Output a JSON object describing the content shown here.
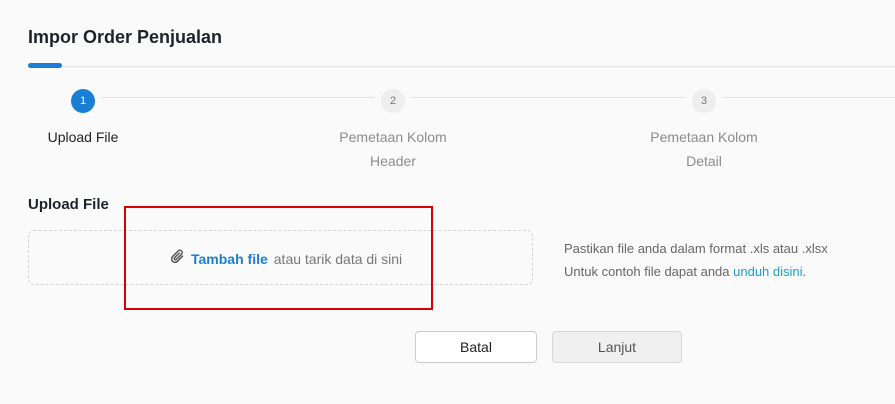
{
  "page": {
    "title": "Impor Order Penjualan"
  },
  "steps": [
    {
      "number": "1",
      "label_line1": "Upload File",
      "label_line2": "",
      "state": "active"
    },
    {
      "number": "2",
      "label_line1": "Pemetaan Kolom",
      "label_line2": "Header",
      "state": "inactive"
    },
    {
      "number": "3",
      "label_line1": "Pemetaan Kolom",
      "label_line2": "Detail",
      "state": "inactive"
    }
  ],
  "upload": {
    "section_label": "Upload File",
    "add_file_label": "Tambah file",
    "drop_hint": "atau tarik data di sini",
    "info_line1": "Pastikan file anda dalam format .xls atau .xlsx",
    "info_line2_prefix": "Untuk contoh file dapat anda",
    "info_link": "unduh disini",
    "info_line2_suffix": "."
  },
  "actions": {
    "cancel_label": "Batal",
    "next_label": "Lanjut"
  },
  "colors": {
    "accent": "#1a7fd4",
    "link": "#1a9fd4",
    "highlight": "#d60000"
  }
}
